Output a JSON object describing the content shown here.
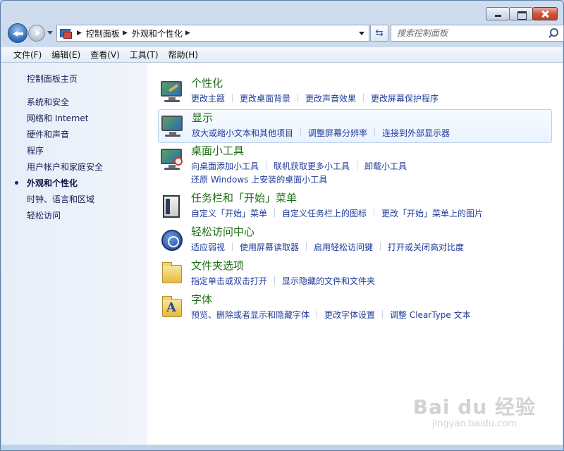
{
  "window": {
    "caption_buttons": [
      "minimize",
      "maximize",
      "close"
    ]
  },
  "nav": {
    "breadcrumbs": [
      "控制面板",
      "外观和个性化"
    ],
    "search_placeholder": "搜索控制面板"
  },
  "menu": [
    "文件(F)",
    "编辑(E)",
    "查看(V)",
    "工具(T)",
    "帮助(H)"
  ],
  "sidebar": {
    "home": "控制面板主页",
    "items": [
      {
        "label": "系统和安全",
        "active": false
      },
      {
        "label": "网络和 Internet",
        "active": false
      },
      {
        "label": "硬件和声音",
        "active": false
      },
      {
        "label": "程序",
        "active": false
      },
      {
        "label": "用户帐户和家庭安全",
        "active": false
      },
      {
        "label": "外观和个性化",
        "active": true
      },
      {
        "label": "时钟、语言和区域",
        "active": false
      },
      {
        "label": "轻松访问",
        "active": false
      }
    ]
  },
  "categories": [
    {
      "title": "个性化",
      "icon": "personalization-icon",
      "links": [
        "更改主题",
        "更改桌面背景",
        "更改声音效果",
        "更改屏幕保护程序"
      ]
    },
    {
      "title": "显示",
      "icon": "display-icon",
      "links": [
        "放大或缩小文本和其他项目",
        "调整屏幕分辨率",
        "连接到外部显示器"
      ]
    },
    {
      "title": "桌面小工具",
      "icon": "gadgets-icon",
      "links": [
        "向桌面添加小工具",
        "联机获取更多小工具",
        "卸载小工具",
        "还原 Windows 上安装的桌面小工具"
      ]
    },
    {
      "title": "任务栏和「开始」菜单",
      "icon": "taskbar-icon",
      "links": [
        "自定义「开始」菜单",
        "自定义任务栏上的图标",
        "更改「开始」菜单上的图片"
      ]
    },
    {
      "title": "轻松访问中心",
      "icon": "ease-of-access-icon",
      "links": [
        "适应弱视",
        "使用屏幕读取器",
        "启用轻松访问键",
        "打开或关闭高对比度"
      ]
    },
    {
      "title": "文件夹选项",
      "icon": "folder-options-icon",
      "links": [
        "指定单击或双击打开",
        "显示隐藏的文件和文件夹"
      ]
    },
    {
      "title": "字体",
      "icon": "fonts-icon",
      "links": [
        "预览、删除或者显示和隐藏字体",
        "更改字体设置",
        "调整 ClearType 文本"
      ]
    }
  ],
  "watermark": {
    "main": "Bai du 经验",
    "sub": "jingyan.baidu.com"
  },
  "colors": {
    "title_green": "#1e6f15",
    "link_blue": "#1f3b9a",
    "sidebar_text": "#151c55"
  }
}
